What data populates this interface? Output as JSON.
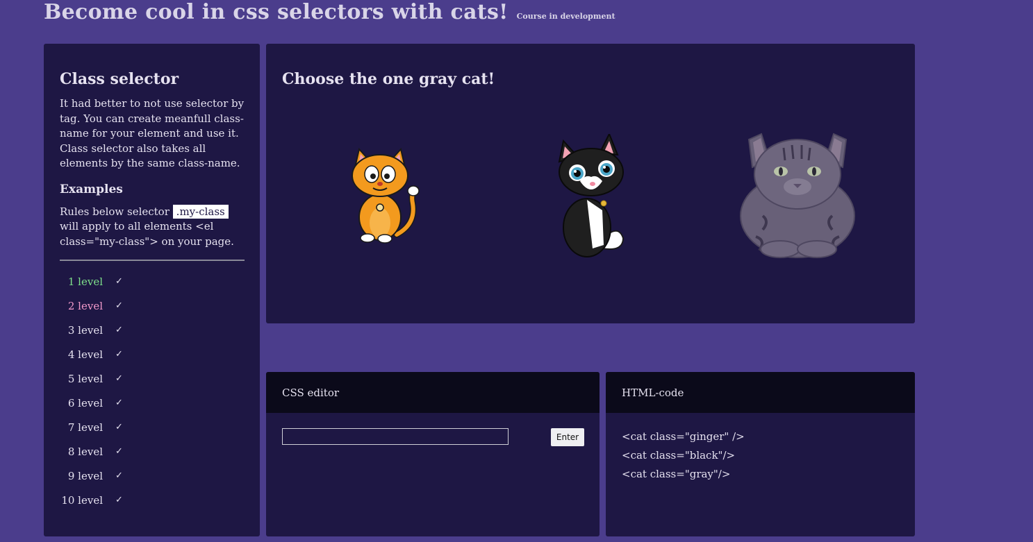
{
  "header": {
    "title": "Become cool in css selectors with cats!",
    "subtitle": "Course in development"
  },
  "sidebar": {
    "title": "Class selector",
    "description": "It had better to not use selector by tag. You can create meanfull class-name for your element and use it. Class selector also takes all elements by the same class-name.",
    "examples_title": "Examples",
    "example_prefix": "Rules below selector",
    "example_code": ".my-class",
    "example_suffix": "will apply to all elements <el class=\"my-class\"> on your page.",
    "levels": [
      {
        "label": "1 level",
        "check": "✓",
        "color": "#7ee08a"
      },
      {
        "label": "2 level",
        "check": "✓",
        "color": "#f29acb"
      },
      {
        "label": "3 level",
        "check": "✓",
        "color": "#e6e2f0"
      },
      {
        "label": "4 level",
        "check": "✓",
        "color": "#e6e2f0"
      },
      {
        "label": "5 level",
        "check": "✓",
        "color": "#e6e2f0"
      },
      {
        "label": "6 level",
        "check": "✓",
        "color": "#e6e2f0"
      },
      {
        "label": "7 level",
        "check": "✓",
        "color": "#e6e2f0"
      },
      {
        "label": "8 level",
        "check": "✓",
        "color": "#e6e2f0"
      },
      {
        "label": "9 level",
        "check": "✓",
        "color": "#e6e2f0"
      },
      {
        "label": "10 level",
        "check": "✓",
        "color": "#e6e2f0"
      }
    ]
  },
  "stage": {
    "task": "Choose the one gray cat!",
    "cats": [
      "ginger-cat-icon",
      "black-cat-icon",
      "gray-cat-icon"
    ]
  },
  "editor": {
    "title": "CSS editor",
    "input_value": "",
    "button_label": "Enter"
  },
  "html_code": {
    "title": "HTML-code",
    "lines": [
      "<cat class=\"ginger\" />",
      "<cat class=\"black\"/>",
      "<cat class=\"gray\"/>"
    ]
  },
  "colors": {
    "background": "#4b3d8c",
    "panel": "#1e1744",
    "pane_header": "#0b0a1a",
    "completed_level": "#7ee08a",
    "current_level": "#f29acb"
  }
}
